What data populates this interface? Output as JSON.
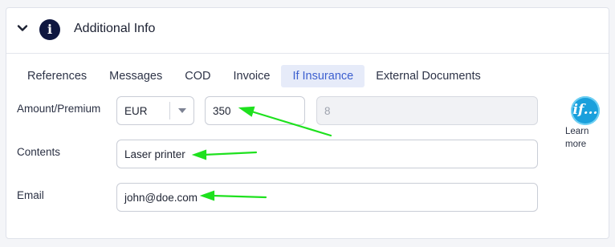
{
  "header": {
    "title": "Additional Info",
    "collapse_icon": "chevron-down-icon",
    "info_icon": "info-icon",
    "info_glyph": "i"
  },
  "tabs": [
    {
      "label": "References"
    },
    {
      "label": "Messages"
    },
    {
      "label": "COD"
    },
    {
      "label": "Invoice"
    },
    {
      "label": "If Insurance",
      "active": true
    },
    {
      "label": "External Documents"
    }
  ],
  "form": {
    "amount_label": "Amount/Premium",
    "currency": "EUR",
    "amount": "350",
    "premium": "8",
    "contents_label": "Contents",
    "contents": "Laser printer",
    "email_label": "Email",
    "email": "john@doe.com"
  },
  "insurer": {
    "logo_icon": "if-logo",
    "logo_text": "if...",
    "learn_more_line1": "Learn",
    "learn_more_line2": "more"
  },
  "colors": {
    "accent": "#3c5fcf",
    "tab_active_bg": "#e6ebf9",
    "annotation_arrow": "#1ee11e",
    "badge_bg": "#0f1740",
    "if_logo_bg": "#1aa0dc"
  }
}
